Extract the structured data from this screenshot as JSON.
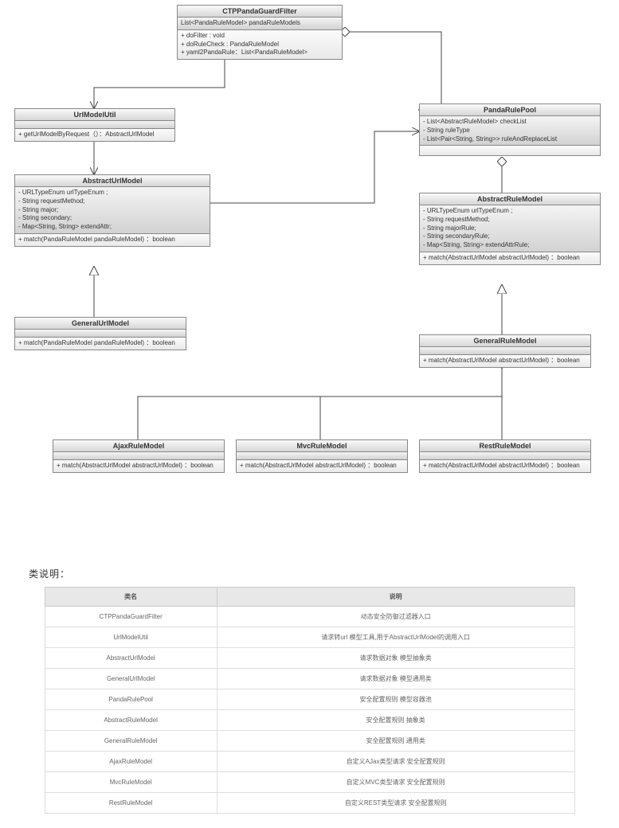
{
  "classes": {
    "filter": {
      "name": "CTPPandaGuardFilter",
      "attrs": [
        "List<PandaRuleModel> pandaRuleModels"
      ],
      "ops": [
        "+ doFilter : void",
        "+ doRuleCheck : PandaRuleModel",
        "+ yaml2PandaRule：List<PandaRuleModel>"
      ]
    },
    "urlutil": {
      "name": "UrlModelUtil",
      "ops": [
        "+ getUrlModelByRequest（）：AbstractUrlModel"
      ]
    },
    "absurl": {
      "name": "AbstractUrlModel",
      "attrs": [
        "- URLTypeEnum urlTypeEnum ;",
        "- String requestMethod;",
        "- String major;",
        "- String secondary;",
        "- Map<String, String> extendAttr;"
      ],
      "ops": [
        "+ match(PandaRuleModel pandaRuleModel) ：boolean"
      ]
    },
    "genurl": {
      "name": "GeneralUrlModel",
      "ops": [
        "+ match(PandaRuleModel pandaRuleModel) ：boolean"
      ]
    },
    "pool": {
      "name": "PandaRulePool",
      "attrs": [
        "- List<AbstractRuleModel> checkList",
        "- String ruleType",
        "- List<Pair<String, String>> ruleAndReplaceList"
      ]
    },
    "absrule": {
      "name": "AbstractRuleModel",
      "attrs": [
        "- URLTypeEnum urlTypeEnum ;",
        "- String requestMethod;",
        "- String majorRule;",
        "- String secondaryRule;",
        "- Map<String, String> extendAttrRule;"
      ],
      "ops": [
        "+ match(AbstractUrlModel abstractUrlModel) ：boolean"
      ]
    },
    "genrule": {
      "name": "GeneralRuleModel",
      "ops": [
        "+ match(AbstractUrlModel abstractUrlModel) ：boolean"
      ]
    },
    "ajax": {
      "name": "AjaxRuleModel",
      "ops": [
        "+ match(AbstractUrlModel abstractUrlModel) ：boolean"
      ]
    },
    "mvc": {
      "name": "MvcRuleModel",
      "ops": [
        "+ match(AbstractUrlModel abstractUrlModel) ：boolean"
      ]
    },
    "rest": {
      "name": "RestRuleModel",
      "ops": [
        "+ match(AbstractUrlModel abstractUrlModel) ：boolean"
      ]
    }
  },
  "table": {
    "title": "类说明：",
    "h1": "类名",
    "h2": "说明",
    "rows": [
      {
        "n": "CTPPandaGuardFilter",
        "d": "动态安全防御过滤器入口"
      },
      {
        "n": "UrlModelUtil",
        "d": "请求转url 模型工具,用于AbstractUrlModel的调用入口"
      },
      {
        "n": "AbstractUrlModel",
        "d": "请求数据对象 模型抽象类"
      },
      {
        "n": "GeneralUrlModel",
        "d": "请求数据对象 模型通用类"
      },
      {
        "n": "PandaRulePool",
        "d": "安全配置规则 模型容器池"
      },
      {
        "n": "AbstractRuleModel",
        "d": "安全配置规则 抽象类"
      },
      {
        "n": "GeneralRuleModel",
        "d": "安全配置规则 通用类"
      },
      {
        "n": "AjaxRuleModel",
        "d": "自定义AJax类型请求 安全配置规则"
      },
      {
        "n": "MvcRuleModel",
        "d": "自定义MVC类型请求 安全配置规则"
      },
      {
        "n": "RestRuleModel",
        "d": "自定义REST类型请求 安全配置规则"
      }
    ]
  }
}
